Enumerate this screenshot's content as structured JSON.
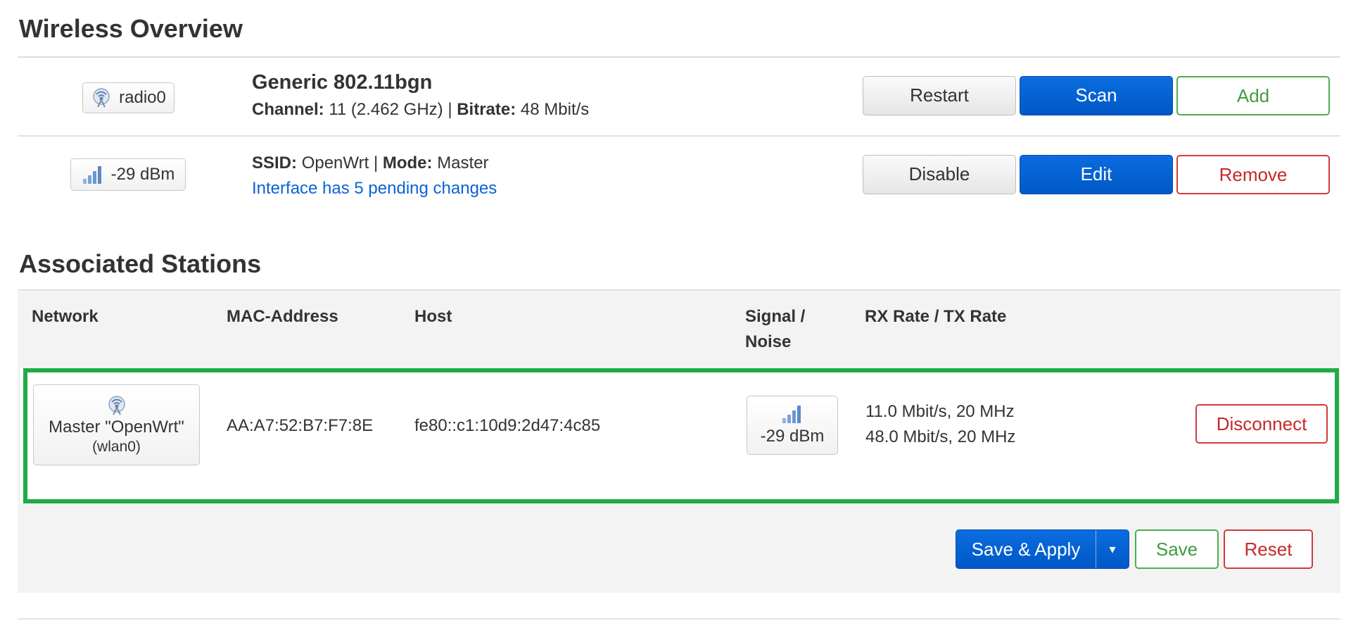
{
  "wireless_overview": {
    "title": "Wireless Overview",
    "radio": {
      "badge_label": "radio0",
      "device_name": "Generic 802.11bgn",
      "channel_label": "Channel:",
      "channel_value": "11 (2.462 GHz)",
      "separator": "|",
      "bitrate_label": "Bitrate:",
      "bitrate_value": "48 Mbit/s",
      "buttons": {
        "restart": "Restart",
        "scan": "Scan",
        "add": "Add"
      }
    },
    "interface": {
      "signal_badge": "-29 dBm",
      "ssid_label": "SSID:",
      "ssid_value": "OpenWrt",
      "separator": "|",
      "mode_label": "Mode:",
      "mode_value": "Master",
      "pending_text": "Interface has 5 pending changes",
      "buttons": {
        "disable": "Disable",
        "edit": "Edit",
        "remove": "Remove"
      }
    }
  },
  "associated_stations": {
    "title": "Associated Stations",
    "columns": {
      "network": "Network",
      "mac": "MAC-Address",
      "host": "Host",
      "signal_line1": "Signal /",
      "signal_line2": "Noise",
      "rates": "RX Rate / TX Rate"
    },
    "rows": [
      {
        "network_line1": "Master \"OpenWrt\"",
        "network_line2": "(wlan0)",
        "mac": "AA:A7:52:B7:F7:8E",
        "host": "fe80::c1:10d9:2d47:4c85",
        "signal": "-29 dBm",
        "rx_rate": "11.0 Mbit/s, 20 MHz",
        "tx_rate": "48.0 Mbit/s, 20 MHz",
        "disconnect": "Disconnect"
      }
    ]
  },
  "footer_actions": {
    "save_apply": "Save & Apply",
    "dropdown_glyph": "▾",
    "save": "Save",
    "reset": "Reset"
  },
  "colors": {
    "primary": "#0058c6",
    "positive": "#4bae4f",
    "negative": "#d13c3c",
    "link": "#0a63d6",
    "highlight": "#1faa47"
  }
}
